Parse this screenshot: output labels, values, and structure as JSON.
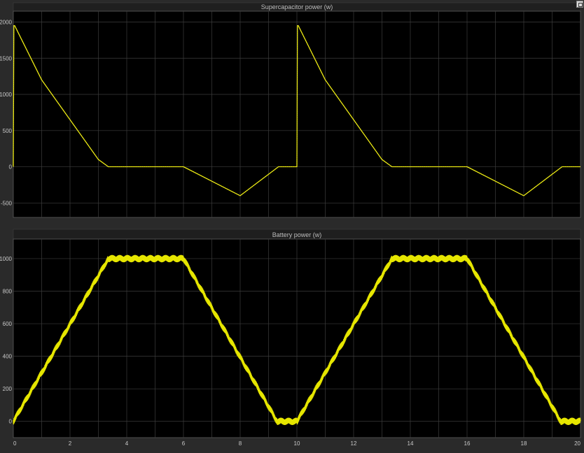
{
  "window": {
    "dock_button_label": ""
  },
  "chart_data": [
    {
      "type": "line",
      "title": "Supercapacitor power (w)",
      "xlabel": "",
      "ylabel": "",
      "xlim": [
        0,
        20
      ],
      "ylim": [
        -700,
        2150
      ],
      "grid": true,
      "xticks": [],
      "yticks": [
        -500,
        0,
        500,
        1000,
        1500,
        2000
      ],
      "line_color": "#e6e600",
      "background": "#000000",
      "grid_color": "#3c3c3c",
      "series": [
        {
          "x": [
            0,
            0.02,
            0.05,
            1.0,
            3.0,
            3.35,
            6.0,
            8.0,
            9.35,
            10.0,
            10.02,
            10.05,
            11.0,
            13.0,
            13.35,
            16.0,
            18.0,
            19.35,
            20.0
          ],
          "y": [
            0,
            1950,
            1950,
            1200,
            100,
            0,
            0,
            -400,
            0,
            0,
            1950,
            1950,
            1200,
            100,
            0,
            0,
            -400,
            0,
            0
          ]
        }
      ]
    },
    {
      "type": "line",
      "title": "Battery power (w)",
      "xlabel": "",
      "ylabel": "",
      "xlim": [
        0,
        20
      ],
      "ylim": [
        -100,
        1120
      ],
      "grid": true,
      "xticks": [
        0,
        2,
        4,
        6,
        8,
        10,
        12,
        14,
        16,
        18,
        20
      ],
      "yticks": [
        0,
        200,
        400,
        600,
        800,
        1000
      ],
      "line_color": "#e6e600",
      "background": "#000000",
      "grid_color": "#3c3c3c",
      "noise_amplitude": 20,
      "series": [
        {
          "x": [
            0,
            3.35,
            6.0,
            9.3,
            10.0,
            13.35,
            16.0,
            19.3,
            20.0
          ],
          "y": [
            0,
            1000,
            1000,
            0,
            0,
            1000,
            1000,
            0,
            0
          ]
        }
      ]
    }
  ]
}
